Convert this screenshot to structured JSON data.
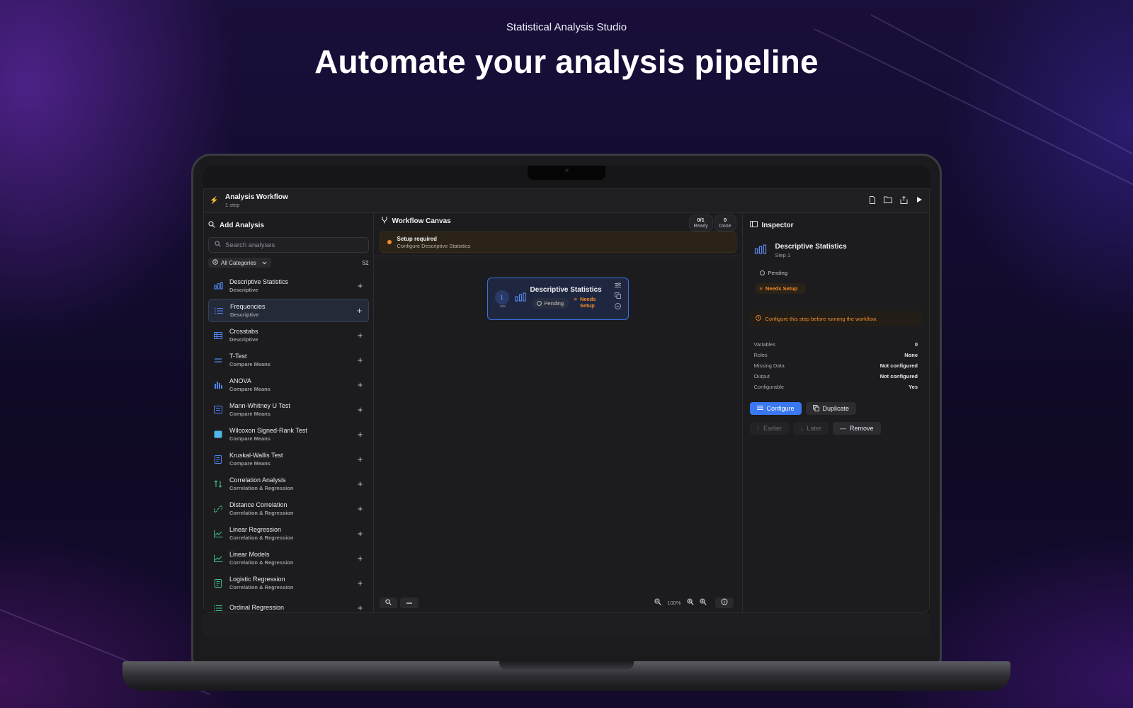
{
  "hero": {
    "subtitle": "Statistical Analysis Studio",
    "title": "Automate your analysis pipeline"
  },
  "app": {
    "title": "Analysis Workflow",
    "subtitle": "1 step",
    "toolbar_icons": [
      "new-file-icon",
      "open-folder-icon",
      "export-icon",
      "run-icon"
    ]
  },
  "left_panel": {
    "heading": "Add Analysis",
    "search_placeholder": "Search analyses",
    "filter_label": "All Categories",
    "count": "52",
    "items": [
      {
        "name": "Descriptive Statistics",
        "category": "Descriptive",
        "icon": "bar-chart-icon",
        "color": "#4f86f7"
      },
      {
        "name": "Frequencies",
        "category": "Descriptive",
        "icon": "list-icon",
        "color": "#4f86f7"
      },
      {
        "name": "Crosstabs",
        "category": "Descriptive",
        "icon": "table-icon",
        "color": "#4f86f7"
      },
      {
        "name": "T-Test",
        "category": "Compare Means",
        "icon": "equals-icon",
        "color": "#4f86f7"
      },
      {
        "name": "ANOVA",
        "category": "Compare Means",
        "icon": "histogram-icon",
        "color": "#4f86f7"
      },
      {
        "name": "Mann-Whitney U Test",
        "category": "Compare Means",
        "icon": "box-icon",
        "color": "#4f86f7"
      },
      {
        "name": "Wilcoxon Signed-Rank Test",
        "category": "Compare Means",
        "icon": "square-icon",
        "color": "#4fb8e8"
      },
      {
        "name": "Kruskal-Wallis Test",
        "category": "Compare Means",
        "icon": "document-icon",
        "color": "#4f86f7"
      },
      {
        "name": "Correlation Analysis",
        "category": "Correlation & Regression",
        "icon": "arrows-icon",
        "color": "#3fc08a"
      },
      {
        "name": "Distance Correlation",
        "category": "Correlation & Regression",
        "icon": "link-icon",
        "color": "#3fc08a"
      },
      {
        "name": "Linear Regression",
        "category": "Correlation & Regression",
        "icon": "trend-icon",
        "color": "#3fc08a"
      },
      {
        "name": "Linear Models",
        "category": "Correlation & Regression",
        "icon": "trend-icon",
        "color": "#3fc08a"
      },
      {
        "name": "Logistic Regression",
        "category": "Correlation & Regression",
        "icon": "document-icon",
        "color": "#3fc08a"
      },
      {
        "name": "Ordinal Regression",
        "category": "",
        "icon": "list-icon",
        "color": "#3fc08a"
      }
    ]
  },
  "canvas": {
    "heading": "Workflow Canvas",
    "stats": [
      {
        "value": "0/1",
        "label": "Ready"
      },
      {
        "value": "0",
        "label": "Done"
      }
    ],
    "banner_title": "Setup required",
    "banner_subtitle": "Configure Descriptive Statistics",
    "node": {
      "number": "1",
      "title": "Descriptive Statistics",
      "status": "Pending",
      "needs_line1": "Needs",
      "needs_line2": "Setup"
    },
    "zoom_level": "100%"
  },
  "inspector": {
    "heading": "Inspector",
    "title": "Descriptive Statistics",
    "step": "Step 1",
    "status": "Pending",
    "needs": "Needs Setup",
    "warning": "Configure this step before running the workflow.",
    "properties": [
      {
        "key": "Variables",
        "value": "0"
      },
      {
        "key": "Roles",
        "value": "None"
      },
      {
        "key": "Missing Data",
        "value": "Not configured"
      },
      {
        "key": "Output",
        "value": "Not configured"
      },
      {
        "key": "Configurable",
        "value": "Yes"
      }
    ],
    "configure_label": "Configure",
    "duplicate_label": "Duplicate",
    "earlier_label": "Earlier",
    "later_label": "Later",
    "remove_label": "Remove"
  },
  "colors": {
    "accent": "#3a78f2",
    "warning": "#f08c2c"
  }
}
